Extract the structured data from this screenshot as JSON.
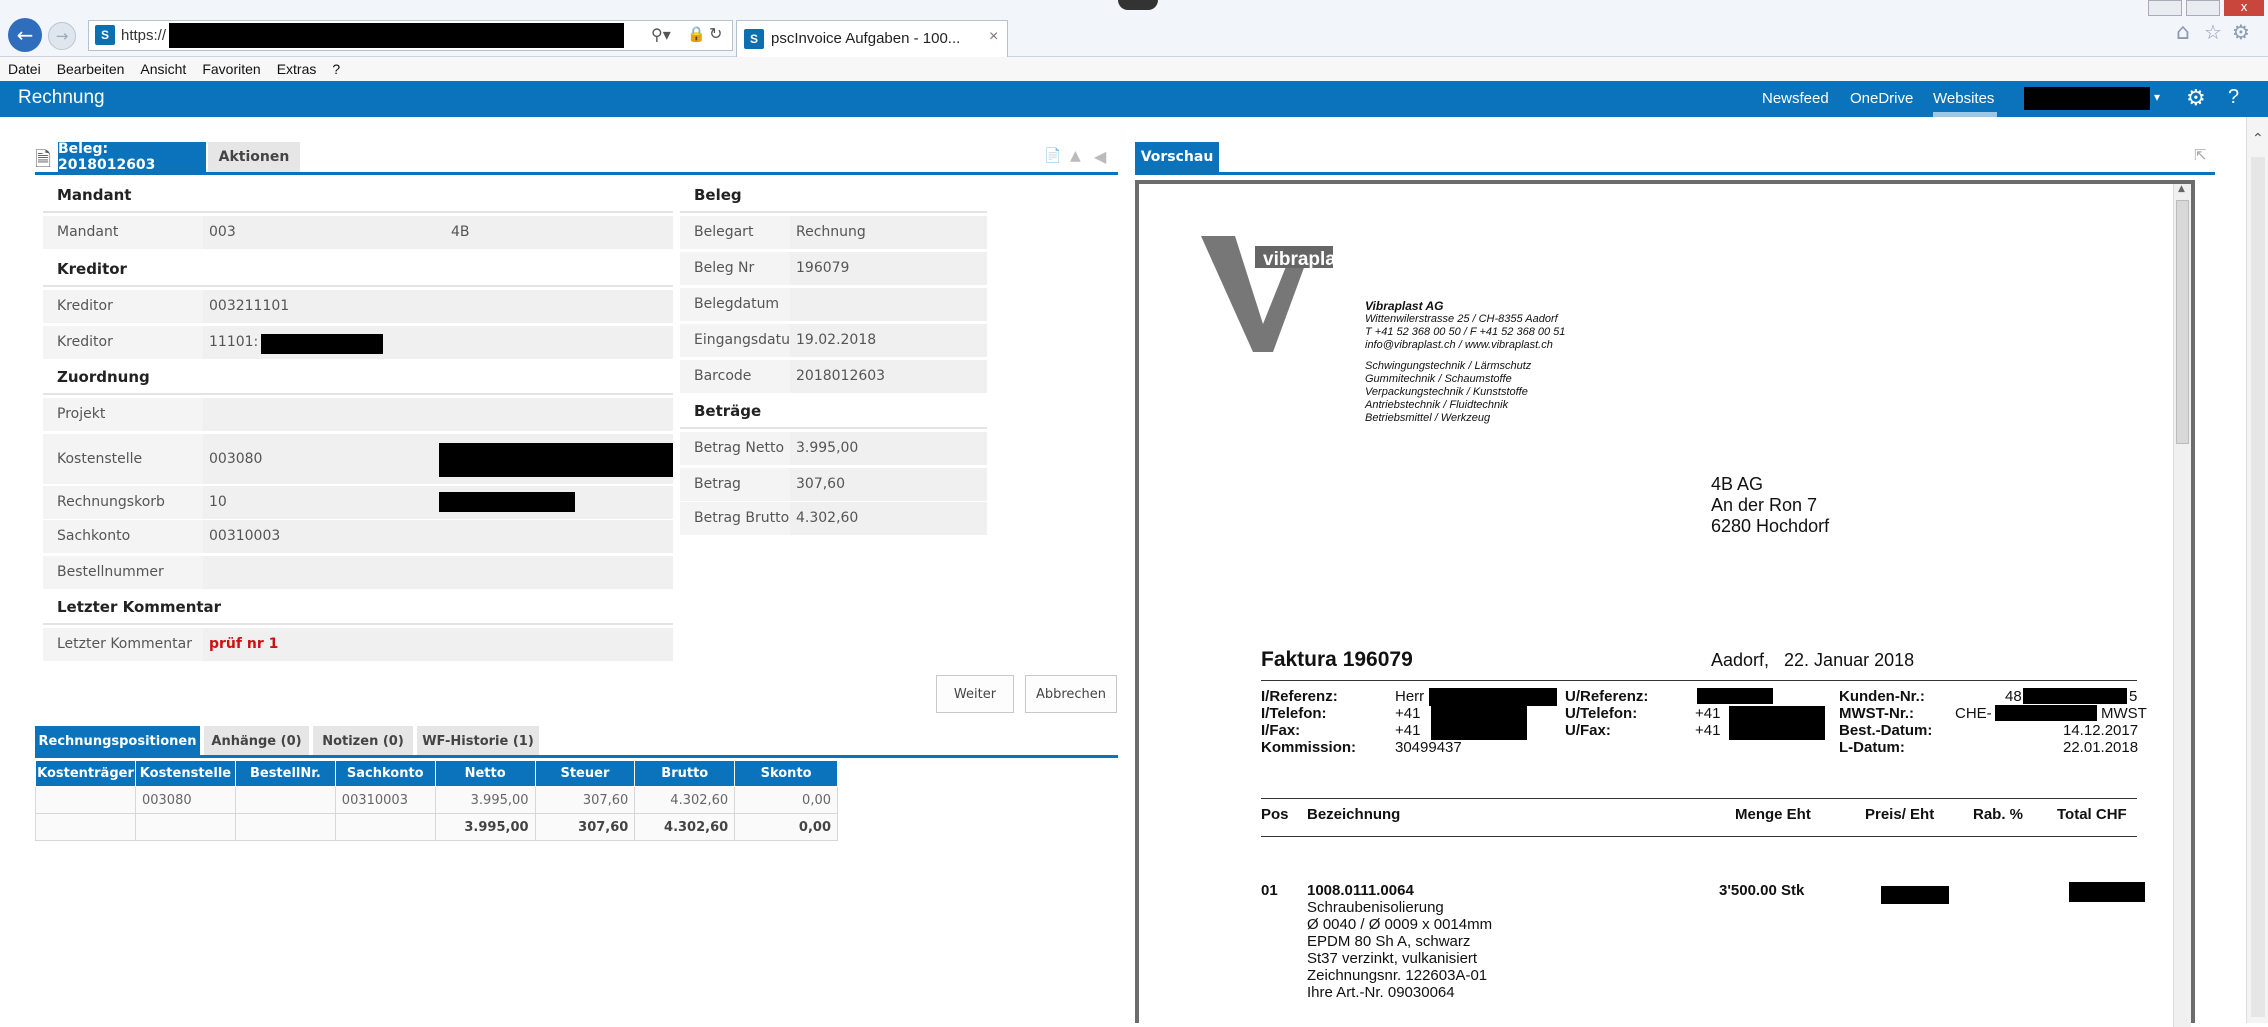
{
  "browser": {
    "url": "https://",
    "tab_title": "pscInvoice Aufgaben - 100...",
    "tab_close": "×",
    "menu": [
      "Datei",
      "Bearbeiten",
      "Ansicht",
      "Favoriten",
      "Extras",
      "?"
    ]
  },
  "suite": {
    "title": "Rechnung",
    "links": [
      "Newsfeed",
      "OneDrive",
      "Websites"
    ]
  },
  "beleg_tabs": {
    "active": "Beleg: 2018012603",
    "other": "Aktionen"
  },
  "left": {
    "mandant_header": "Mandant",
    "mandant_label": "Mandant",
    "mandant_value": "003",
    "mandant_value2": "4B",
    "kreditor_header": "Kreditor",
    "kreditor_label": "Kreditor",
    "kreditor_value": "003211101",
    "kreditor_bez_label": "Kreditor Bezeichnung",
    "kreditor_bez_value": "11101:",
    "zuordnung_header": "Zuordnung",
    "projekt_label": "Projekt",
    "kostenstelle_label": "Kostenstelle",
    "kostenstelle_value": "003080",
    "rechnungskorb_label": "Rechnungskorb",
    "rechnungskorb_value": "10",
    "sachkonto_label": "Sachkonto",
    "sachkonto_value": "00310003",
    "bestellnummer_label": "Bestellnummer",
    "kommentar_header": "Letzter Kommentar",
    "kommentar_label": "Letzter Kommentar",
    "kommentar_value": "prüf nr 1"
  },
  "right": {
    "beleg_header": "Beleg",
    "belegart_label": "Belegart",
    "belegart_value": "Rechnung",
    "belegnr_label": "Beleg Nr",
    "belegnr_value": "196079",
    "belegdatum_label": "Belegdatum",
    "eingangsdatum_label": "Eingangsdatum",
    "eingangsdatum_value": "19.02.2018",
    "barcode_label": "Barcode",
    "barcode_value": "2018012603",
    "betraege_header": "Beträge",
    "netto_label": "Betrag Netto",
    "netto_value": "3.995,00",
    "steuer_label": "Betrag Steuer",
    "steuer_value": "307,60",
    "brutto_label": "Betrag Brutto",
    "brutto_value": "4.302,60"
  },
  "buttons": {
    "weiter": "Weiter",
    "abbrechen": "Abbrechen"
  },
  "bottom_tabs": [
    "Rechnungspositionen",
    "Anhänge (0)",
    "Notizen (0)",
    "WF-Historie (1)"
  ],
  "grid": {
    "columns": [
      "Kostenträger",
      "Kostenstelle",
      "BestellNr.",
      "Sachkonto",
      "Netto",
      "Steuer",
      "Brutto",
      "Skonto"
    ],
    "row": [
      "",
      "003080",
      "",
      "00310003",
      "3.995,00",
      "307,60",
      "4.302,60",
      "0,00"
    ],
    "totals": [
      "",
      "",
      "",
      "",
      "3.995,00",
      "307,60",
      "4.302,60",
      "0,00"
    ]
  },
  "preview": {
    "tab": "Vorschau",
    "logo_text": "vibraplast",
    "company": "Vibraplast AG",
    "address": "Wittenwilerstrasse 25 / CH-8355 Aadorf",
    "phone": "T +41 52 368 00 50 / F +41 52 368 00 51",
    "web": "info@vibraplast.ch / www.vibraplast.ch",
    "products": [
      "Schwingungstechnik / Lärmschutz",
      "Gummitechnik / Schaumstoffe",
      "Verpackungstechnik / Kunststoffe",
      "Antriebstechnik / Fluidtechnik",
      "Betriebsmittel / Werkzeug"
    ],
    "recipient": [
      "4B AG",
      "An der Ron 7",
      "6280 Hochdorf"
    ],
    "invoice_title": "Faktura 196079",
    "invoice_place_date": "Aadorf,   22. Januar 2018",
    "i_ref_label": "I/Referenz:",
    "i_ref_value": "Herr",
    "i_tel_label": "I/Telefon:",
    "i_tel_value": "+41",
    "i_fax_label": "I/Fax:",
    "i_fax_value": "+41",
    "kommission_label": "Kommission:",
    "kommission_value": "30499437",
    "u_ref_label": "U/Referenz:",
    "u_tel_label": "U/Telefon:",
    "u_tel_value": "+41",
    "u_fax_label": "U/Fax:",
    "u_fax_value": "+41",
    "kunden_label": "Kunden-Nr.:",
    "kunden_prefix": "48",
    "kunden_suffix": "5",
    "mwst_label": "MWST-Nr.:",
    "mwst_prefix": "CHE-",
    "mwst_suffix": "MWST",
    "best_label": "Best.-Datum:",
    "best_value": "14.12.2017",
    "l_label": "L-Datum:",
    "l_value": "22.01.2018",
    "col_pos": "Pos",
    "col_bez": "Bezeichnung",
    "col_menge": "Menge Eht",
    "col_preis": "Preis/ Eht",
    "col_rab": "Rab. %",
    "col_total": "Total CHF",
    "item_pos": "01",
    "item_code": "1008.0111.0064",
    "item_lines": [
      "Schraubenisolierung",
      "Ø 0040 / Ø 0009 x 0014mm",
      "EPDM 80 Sh A, schwarz",
      "St37 verzinkt, vulkanisiert",
      "Zeichnungsnr. 122603A-01",
      "Ihre Art.-Nr. 09030064"
    ],
    "item_menge": "3'500.00 Stk"
  },
  "colors": {
    "accent": "#0a73bc",
    "comment_red": "#cc1111"
  }
}
